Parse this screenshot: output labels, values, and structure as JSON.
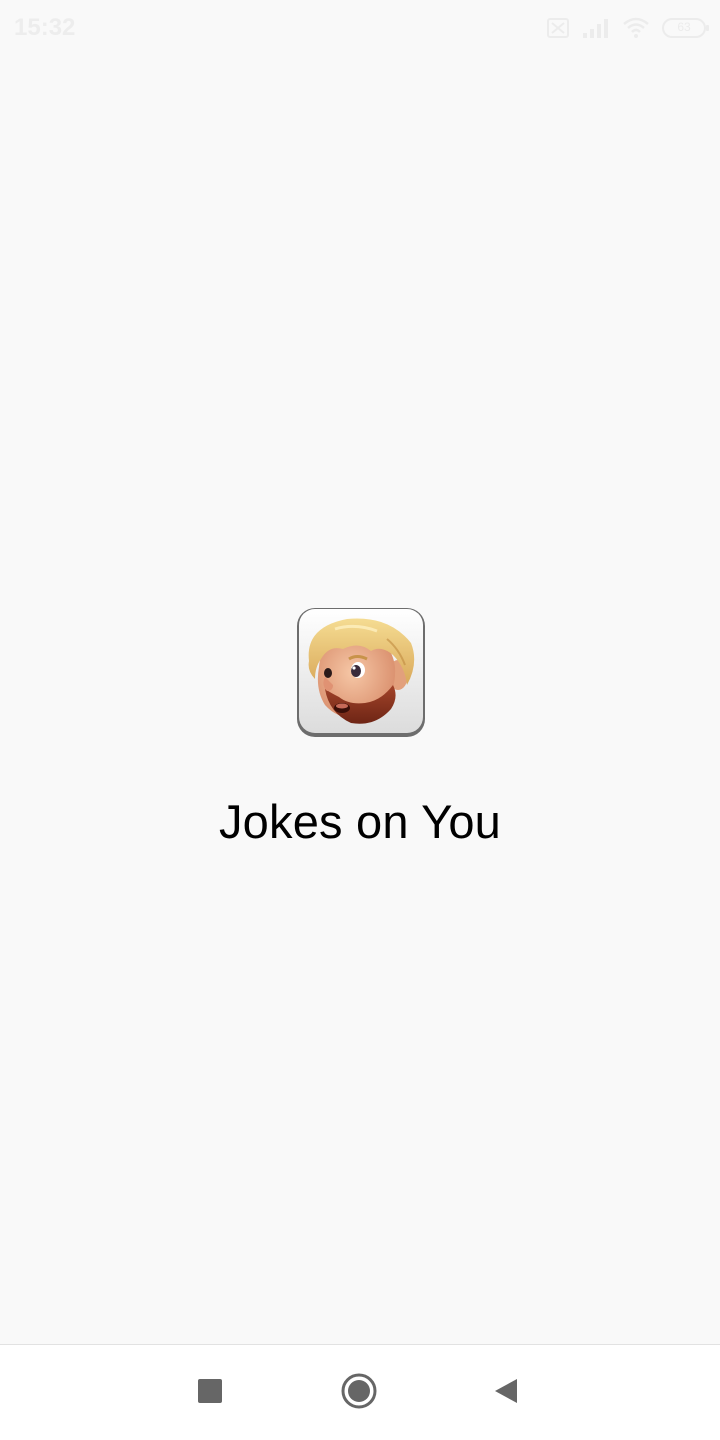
{
  "status_bar": {
    "time": "15:32",
    "battery_level": "63",
    "icons": [
      "sim-icon",
      "signal-icon",
      "wifi-icon",
      "battery-icon"
    ]
  },
  "splash": {
    "app_title": "Jokes on You",
    "app_icon": "bearded-face-app-icon"
  },
  "nav_bar": {
    "buttons": [
      "recents-square-icon",
      "home-circle-icon",
      "back-triangle-icon"
    ]
  },
  "colors": {
    "background": "#f9f9f9",
    "nav_background": "#ffffff",
    "nav_icon": "#666666",
    "title_text": "#000000"
  }
}
